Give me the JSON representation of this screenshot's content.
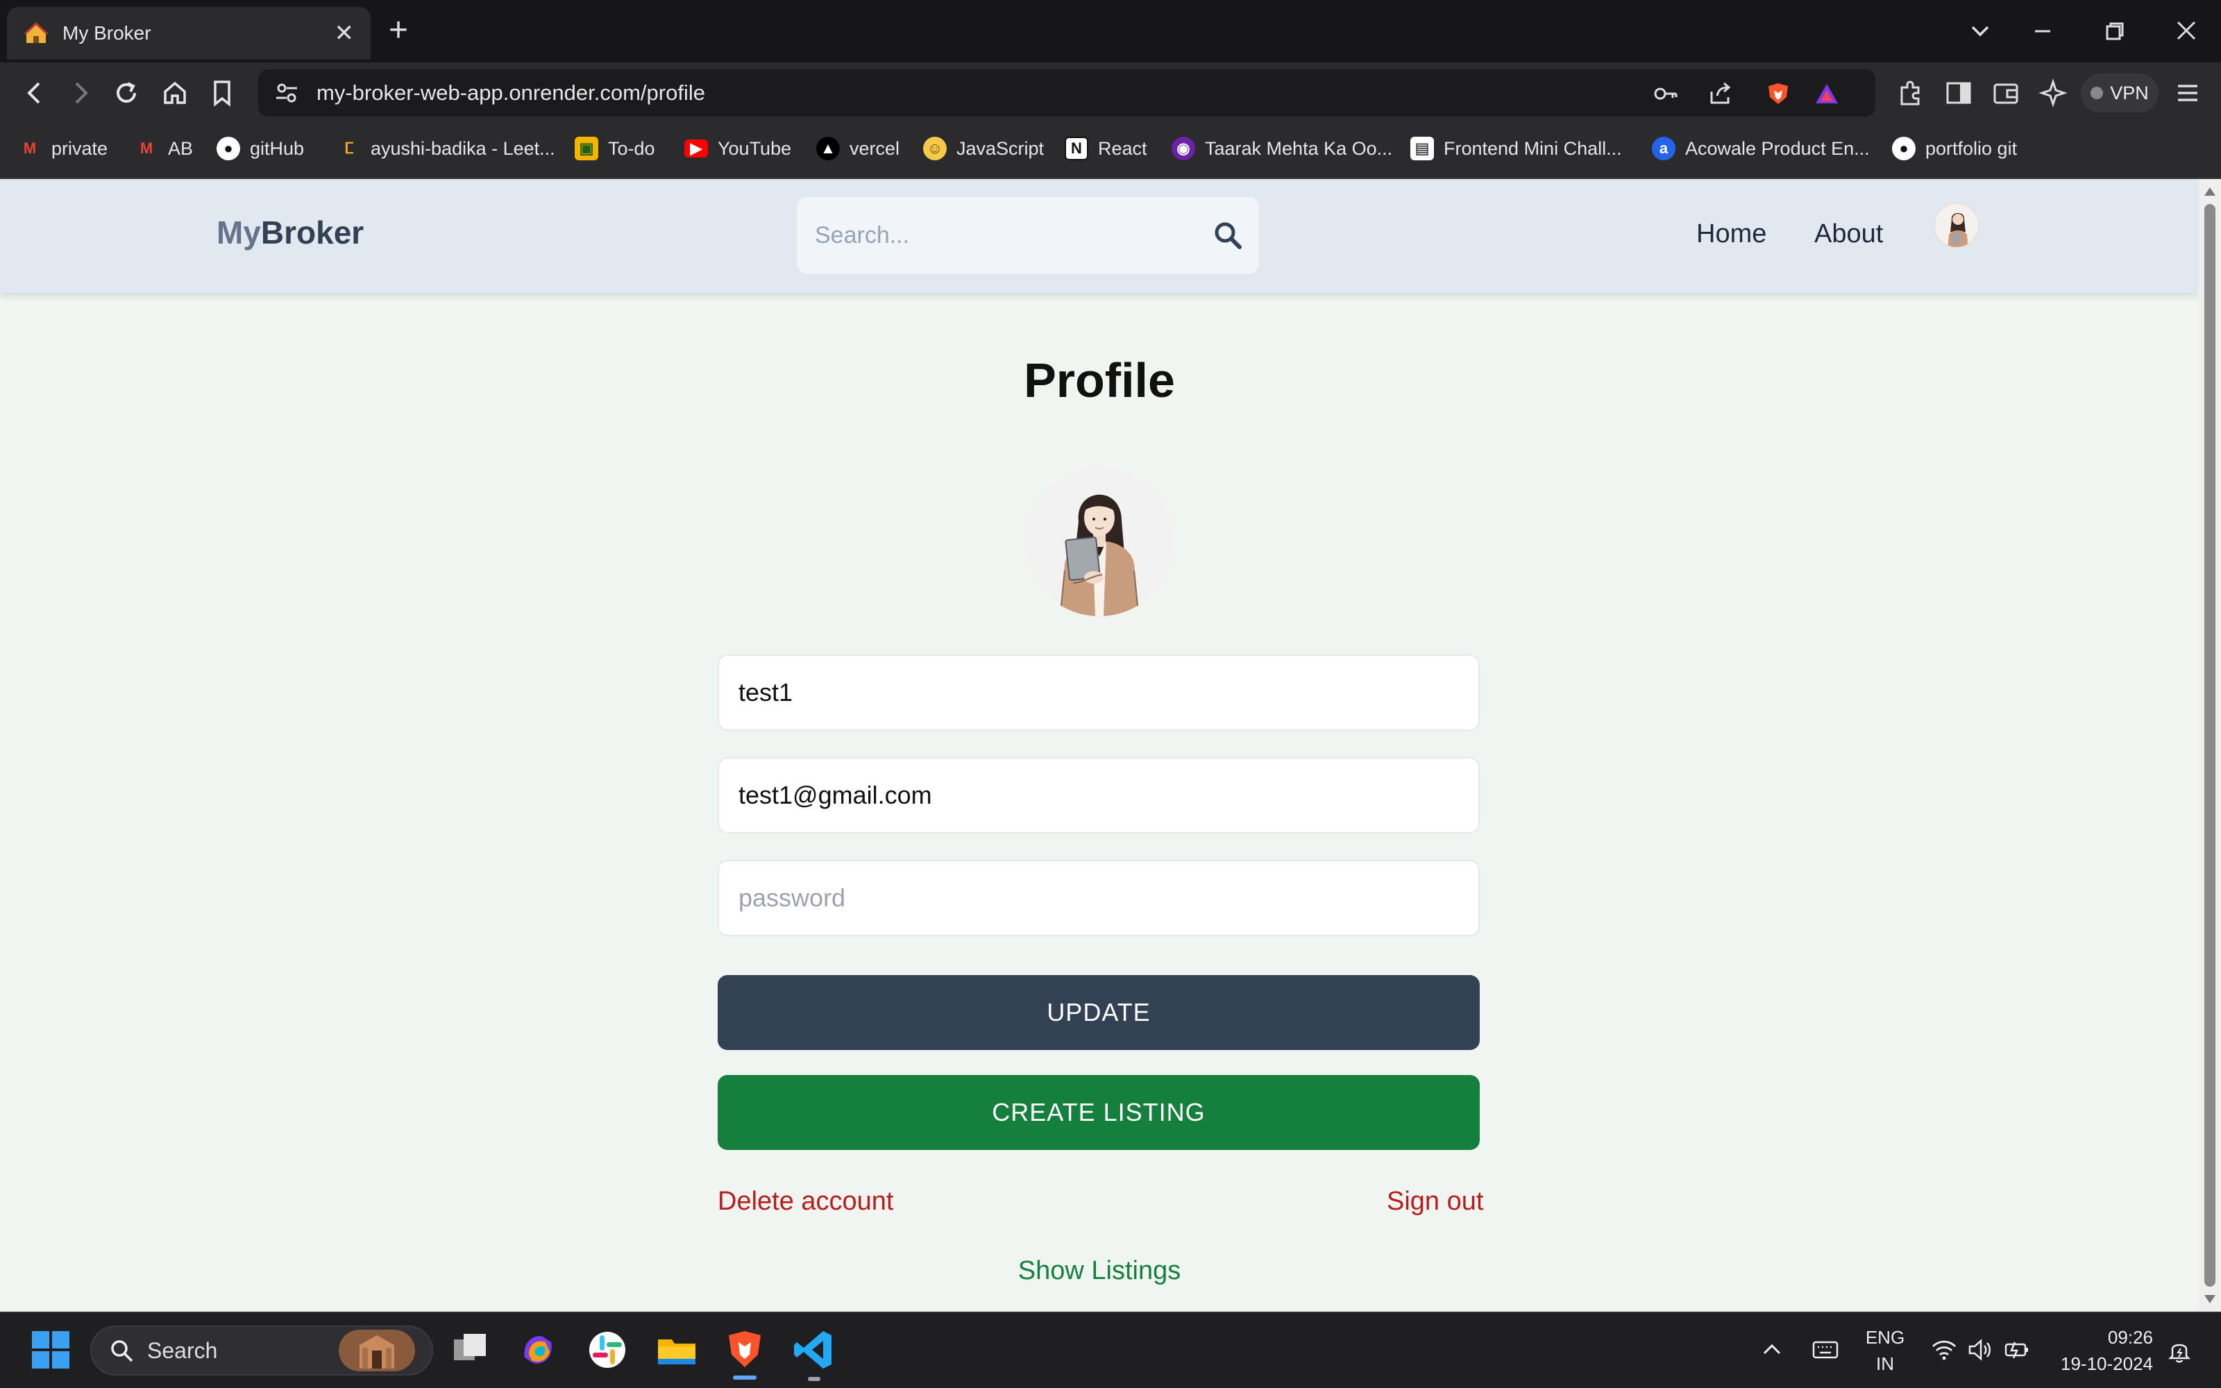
{
  "browser": {
    "tab_title": "My Broker",
    "url": "my-broker-web-app.onrender.com/profile",
    "vpn_label": "VPN",
    "bookmarks": [
      {
        "label": "private",
        "icon": "gmail-icon"
      },
      {
        "label": "AB",
        "icon": "gmail-icon"
      },
      {
        "label": "gitHub",
        "icon": "github-icon"
      },
      {
        "label": "ayushi-badika - Leet...",
        "icon": "leetcode-icon"
      },
      {
        "label": "To-do",
        "icon": "classroom-icon"
      },
      {
        "label": "YouTube",
        "icon": "youtube-icon"
      },
      {
        "label": "vercel",
        "icon": "vercel-icon"
      },
      {
        "label": "JavaScript",
        "icon": "emoji-icon"
      },
      {
        "label": "React",
        "icon": "notion-icon"
      },
      {
        "label": "Taarak Mehta Ka Oo...",
        "icon": "sonyliv-icon"
      },
      {
        "label": "Frontend Mini Chall...",
        "icon": "page-icon"
      },
      {
        "label": "Acowale Product En...",
        "icon": "acowale-icon"
      },
      {
        "label": "portfolio git",
        "icon": "github-icon"
      }
    ]
  },
  "site": {
    "logo_part1": "My",
    "logo_part2": "Broker",
    "search_placeholder": "Search...",
    "nav": {
      "home": "Home",
      "about": "About"
    }
  },
  "profile": {
    "title": "Profile",
    "username": "test1",
    "email": "test1@gmail.com",
    "password_placeholder": "password",
    "update_label": "UPDATE",
    "create_listing_label": "CREATE LISTING",
    "delete_account_label": "Delete account",
    "sign_out_label": "Sign out",
    "show_listings_label": "Show Listings"
  },
  "taskbar": {
    "search_label": "Search",
    "lang_line1": "ENG",
    "lang_line2": "IN",
    "time": "09:26",
    "date": "19-10-2024"
  },
  "colors": {
    "header_bg": "#e2e8f0",
    "page_bg": "#f1f5f1",
    "update_button": "#334155",
    "create_listing_button": "#15803d",
    "danger_link": "#b91c1c",
    "success_link": "#15803d"
  }
}
